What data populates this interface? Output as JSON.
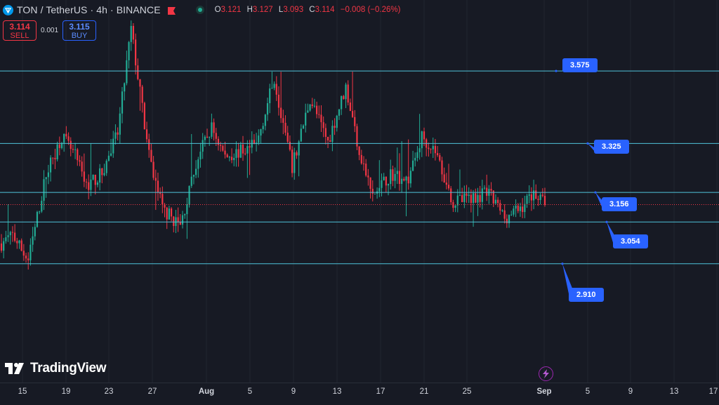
{
  "header": {
    "symbol_title": "TON / TetherUS · 4h · BINANCE",
    "ohlc": [
      {
        "key": "O",
        "value": "3.121"
      },
      {
        "key": "H",
        "value": "3.127"
      },
      {
        "key": "L",
        "value": "3.093"
      },
      {
        "key": "C",
        "value": "3.114"
      }
    ],
    "change": "−0.008 (−0.26%)",
    "symbol_icon": "ton-diamond-icon",
    "flag_icon": "red-flag-icon"
  },
  "trade": {
    "sell_price": "3.114",
    "sell_label": "SELL",
    "spread": "0.001",
    "buy_price": "3.115",
    "buy_label": "BUY"
  },
  "brand": {
    "name": "TradingView",
    "logo_icon": "tradingview-logo-icon"
  },
  "colors": {
    "background": "#171a24",
    "up": "#22ab94",
    "down": "#f23645",
    "level_line": "#4fc3d9",
    "callout": "#2962ff",
    "grid": "#22262f"
  },
  "x_axis": {
    "ticks": [
      {
        "label": "15",
        "bold": false
      },
      {
        "label": "19",
        "bold": false
      },
      {
        "label": "23",
        "bold": false
      },
      {
        "label": "27",
        "bold": false
      },
      {
        "label": "Aug",
        "bold": true
      },
      {
        "label": "5",
        "bold": false
      },
      {
        "label": "9",
        "bold": false
      },
      {
        "label": "13",
        "bold": false
      },
      {
        "label": "17",
        "bold": false
      },
      {
        "label": "21",
        "bold": false
      },
      {
        "label": "25",
        "bold": false
      },
      {
        "label": "Sep",
        "bold": true
      },
      {
        "label": "5",
        "bold": false
      },
      {
        "label": "9",
        "bold": false
      },
      {
        "label": "13",
        "bold": false
      },
      {
        "label": "17",
        "bold": false
      }
    ]
  },
  "chart_data": {
    "type": "candlestick",
    "levels": [
      {
        "value": 3.575,
        "label": "3.575"
      },
      {
        "value": 3.325,
        "label": "3.325"
      },
      {
        "value": 3.156,
        "label": "3.156"
      },
      {
        "value": 3.054,
        "label": "3.054"
      },
      {
        "value": 2.91,
        "label": "2.910"
      }
    ],
    "current_price": 3.114,
    "price_range": [
      2.5,
      3.82
    ],
    "anchors": [
      {
        "i": 0,
        "p": 2.98
      },
      {
        "i": 5,
        "p": 3.01
      },
      {
        "i": 12,
        "p": 2.92
      },
      {
        "i": 20,
        "p": 3.22
      },
      {
        "i": 27,
        "p": 3.35
      },
      {
        "i": 33,
        "p": 3.28
      },
      {
        "i": 38,
        "p": 3.18
      },
      {
        "i": 45,
        "p": 3.22
      },
      {
        "i": 52,
        "p": 3.36
      },
      {
        "i": 58,
        "p": 3.72
      },
      {
        "i": 66,
        "p": 3.28
      },
      {
        "i": 72,
        "p": 3.1
      },
      {
        "i": 80,
        "p": 3.04
      },
      {
        "i": 88,
        "p": 3.28
      },
      {
        "i": 94,
        "p": 3.38
      },
      {
        "i": 100,
        "p": 3.28
      },
      {
        "i": 108,
        "p": 3.3
      },
      {
        "i": 114,
        "p": 3.32
      },
      {
        "i": 122,
        "p": 3.55
      },
      {
        "i": 130,
        "p": 3.24
      },
      {
        "i": 138,
        "p": 3.48
      },
      {
        "i": 146,
        "p": 3.33
      },
      {
        "i": 154,
        "p": 3.52
      },
      {
        "i": 160,
        "p": 3.3
      },
      {
        "i": 166,
        "p": 3.14
      },
      {
        "i": 174,
        "p": 3.22
      },
      {
        "i": 182,
        "p": 3.2
      },
      {
        "i": 188,
        "p": 3.35
      },
      {
        "i": 194,
        "p": 3.3
      },
      {
        "i": 202,
        "p": 3.12
      },
      {
        "i": 210,
        "p": 3.14
      },
      {
        "i": 218,
        "p": 3.15
      },
      {
        "i": 225,
        "p": 3.07
      },
      {
        "i": 232,
        "p": 3.1
      },
      {
        "i": 238,
        "p": 3.16
      },
      {
        "i": 243,
        "p": 3.114
      }
    ],
    "candle_count": 244
  }
}
